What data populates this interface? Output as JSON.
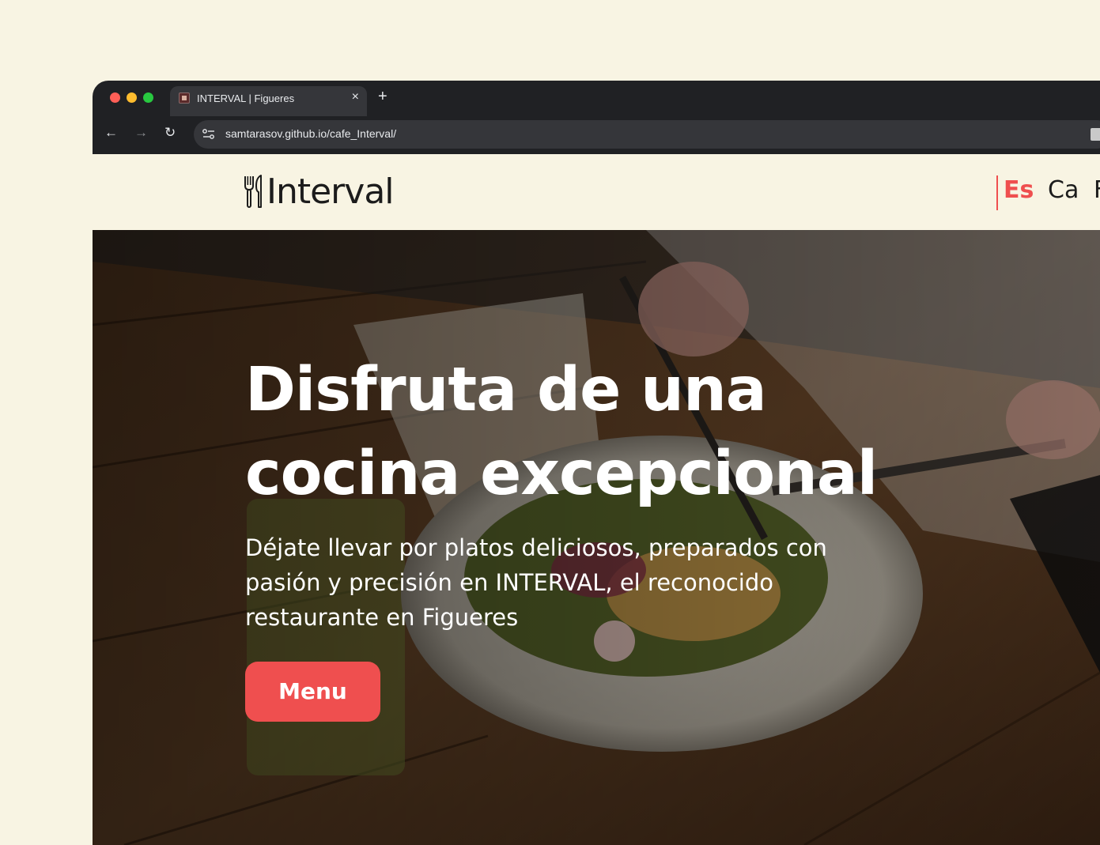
{
  "browser": {
    "tab_title": "INTERVAL | Figueres",
    "close_glyph": "×",
    "new_tab_glyph": "+",
    "back_glyph": "←",
    "forward_glyph": "→",
    "reload_glyph": "↻",
    "url": "samtarasov.github.io/cafe_Interval/"
  },
  "site": {
    "logo_text": "Interval",
    "languages": [
      "Es",
      "Ca",
      "F"
    ],
    "active_language": "Es",
    "accent_color": "#ef4f4f",
    "background_color": "#f8f4e3"
  },
  "hero": {
    "title": "Disfruta de una cocina excepcional",
    "description": "Déjate llevar por platos deliciosos, preparados con pasión y precisión en INTERVAL, el reconocido restaurante en Figueres",
    "button_label": "Menu"
  }
}
